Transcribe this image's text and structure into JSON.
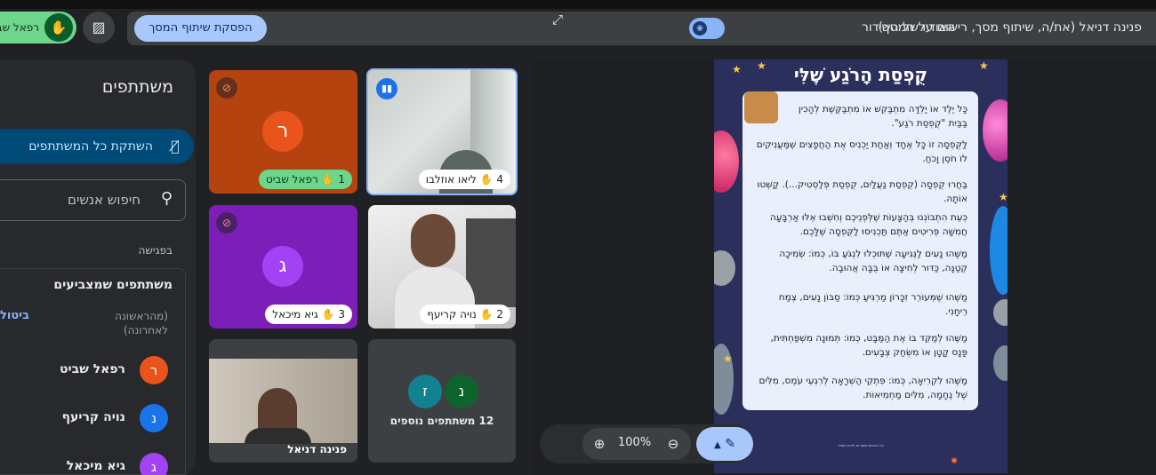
{
  "topbar": {
    "presenter_text": "פנינה דניאל (את/ה, שיתוף מסך, רישום על המסך)",
    "audio_label": "האודיו של השידור",
    "stop_share_label": "הפסקת שיתוף המסך",
    "raised_hand_name": "רפאל שב"
  },
  "sidebar": {
    "title": "משתתפים",
    "mute_all_label": "השתקת כל המשתתפים",
    "search_placeholder": "חיפוש אנשים",
    "in_meeting_label": "בפגישה",
    "raised_hands_title": "משתתפים שמצביעים",
    "sort_label": "(מהראשונה לאחרונה)",
    "lower_all_label": "ביטול",
    "people": [
      {
        "initial": "ר",
        "name": "רפאל שביט",
        "color": "#e8541c"
      },
      {
        "initial": "נ",
        "name": "נויה קריעף",
        "color": "#1a73e8"
      },
      {
        "initial": "ג",
        "name": "גיא מיכאל",
        "color": "#a142f4"
      }
    ]
  },
  "tiles": {
    "t1": {
      "initial": "ר",
      "name": "רפאל שביט",
      "order": "1",
      "color": "#e8541c",
      "bg": "#b5430f"
    },
    "t4": {
      "name": "ליאו אוזלבו",
      "order": "4"
    },
    "t3": {
      "initial": "ג",
      "name": "גיא מיכאל",
      "order": "3",
      "color": "#a142f4",
      "bg": "#7c1fb8"
    },
    "t2": {
      "name": "נויה קריעף",
      "order": "2"
    },
    "self": {
      "name": "פנינה דניאל"
    },
    "more": {
      "initials": [
        "ז",
        "נ"
      ],
      "label": "12 משתתפים נוספים"
    }
  },
  "slide": {
    "title": "קֻפְסַת הָרֹגַע שֶׁלִּי",
    "paragraphs": [
      "כָּל יֶלֶד אוֹ יַלְדָּה מִתְבַּקֵּשׁ אוֹ מִתְבַּקֶּשֶׁת לְהָכִין בַּבַּיִת \"קֻפְסַת רֹגַע\".",
      "לַקֻּפְסָה זוֹ כָּל אֶחָד וְאַחַת יַכְנִיס אֶת הַחֲפָצִים שֶׁמַּעֲנִיקִים לוֹ חֹסֶן וָכֹחַ.",
      "בַּחֲרוּ קֻפְסָה (קֻפְסַת נַעֲלַיִם, קֻפְסַת פְּלַסְטִיק...). קַשְּׁטוּ אוֹתָהּ.",
      "כְּעֵת הִתְבּוֹנְנוּ בְּהַצָּעוֹת שֶׁלְּפְנֵיכֶם וְחִשְׁבוּ אֵלּוּ אַרְבָּעָה חֲמִשָּׁה פְּרִיטִים אַתֶּם תַּכְנִיסוּ לַקֻּפְסָה שֶׁלָּכֶם.",
      "מַשֶּׁהוּ נָעִים לַנְּגִיעָה שֶׁתּוּכְלוּ לִנְגֹּעַ בּוֹ, כְּמוֹ: שְׂמִיכָה קְטַנָּה, כַּדּוּר לְחִיצָה אוֹ בֻּבָּה אֲהוּבָה.",
      "מַשֶּׁהוּ שֶׁמְּעוֹרֵר זִכָּרוֹן מַרְגִּיעַ כְּמוֹ: סַבּוֹן נָעִים, צֶמַח רֵיחָנִי.",
      "מַשֶּׁהוּ לְמַקֵּד בּוֹ אֶת הַמַּבָּט, כְּמוֹ: תְּמוּנָה מִשְׁפַּחְתִּית, פָּנָס קָטָן אוֹ מִשְׂחַק צְבָעִים.",
      "מַשֶּׁהוּ לִקְרִיאָה, כְּמוֹ: פִּתְקֵי הַשְׁרָאָה לְרִגְעֵי עֹמֶס, מִלִּים שֶׁל נֶחָמָה, מִלִּים מַחְמִיאוֹת."
    ],
    "footer": "כל הזכויות שמורות לבית הספר"
  },
  "zoom": {
    "percent": "100%"
  },
  "icons": {
    "raise_hand": "✋",
    "hide_video": "▨",
    "mic_off": "🎙",
    "search": "⚲",
    "zoom_in": "⊕",
    "zoom_out": "⊖",
    "fullscreen": "⤢",
    "annotate": "✎"
  }
}
